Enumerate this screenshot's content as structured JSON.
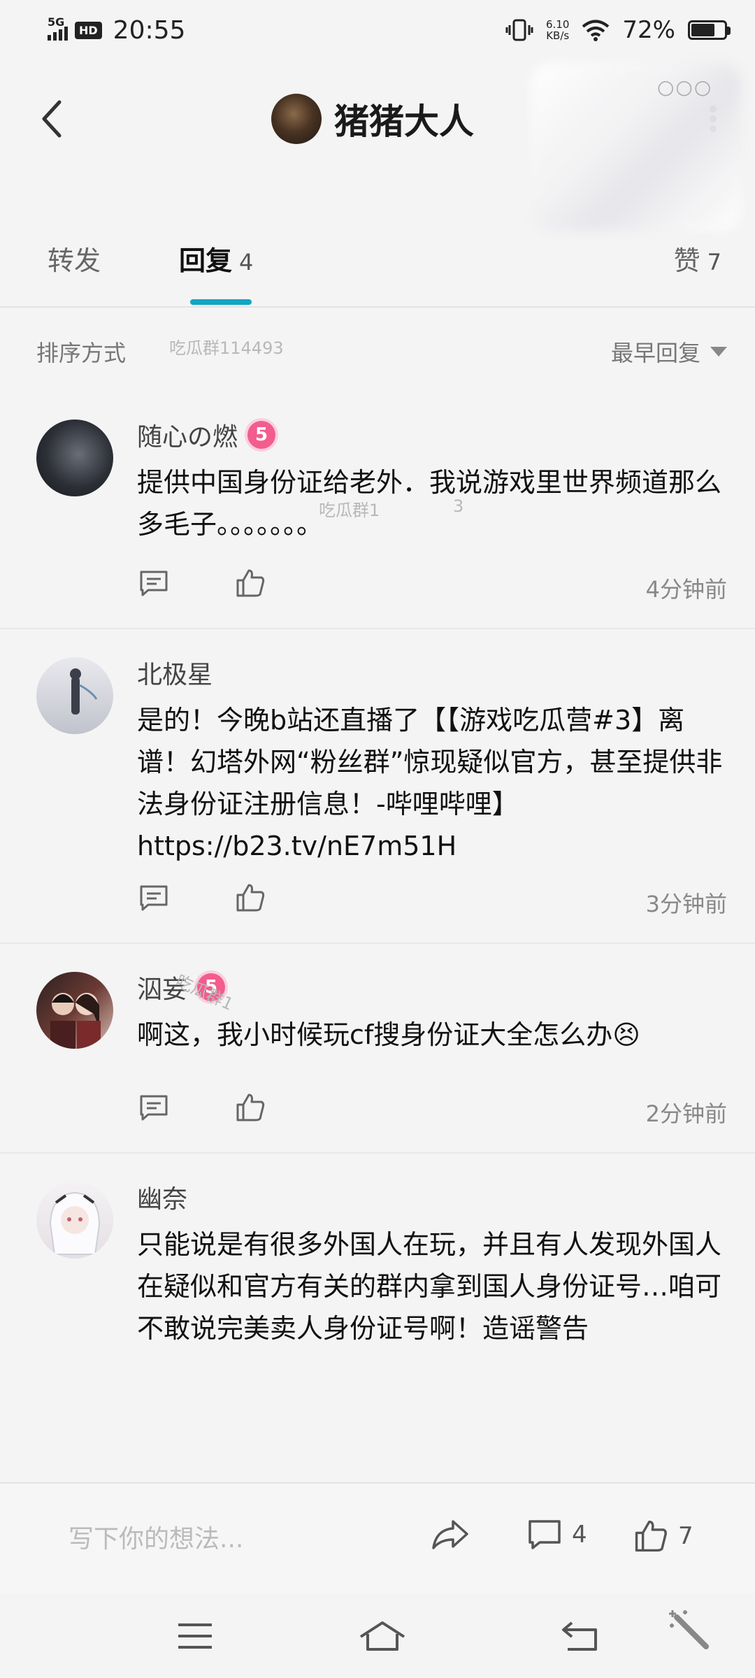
{
  "status_bar": {
    "network": "5G",
    "hd": "HD",
    "time": "20:55",
    "net_speed_value": "6.10",
    "net_speed_unit": "KB/s",
    "battery": "72%",
    "battery_level": 0.72
  },
  "header": {
    "title": "猪猪大人"
  },
  "tabs": [
    {
      "label": "转发",
      "count": ""
    },
    {
      "label": "回复",
      "count": "4"
    },
    {
      "label": "赞",
      "count": "7"
    }
  ],
  "sort": {
    "label": "排序方式",
    "selected": "最早回复"
  },
  "watermarks": [
    "吃瓜群114493",
    "吃瓜群1",
    "3",
    "吃瓜群1"
  ],
  "comments": [
    {
      "name": "随心の燃",
      "level": "5",
      "text": "提供中国身份证给老外．我说游戏里世界频道那么多毛子。。。。。。。",
      "time": "4分钟前"
    },
    {
      "name": "北极星",
      "level": "",
      "text": "是的！今晚b站还直播了【【游戏吃瓜营#3】离谱！幻塔外网“粉丝群”惊现疑似官方，甚至提供非法身份证注册信息！-哔哩哔哩】https://b23.tv/nE7m51H",
      "time": "3分钟前"
    },
    {
      "name": "泅妄",
      "level": "5",
      "text": "啊这，我小时候玩cf搜身份证大全怎么办😣",
      "time": "2分钟前"
    },
    {
      "name": "幽奈",
      "level": "",
      "text": "只能说是有很多外国人在玩，并且有人发现外国人在疑似和官方有关的群内拿到国人身份证号…咱可不敢说完美卖人身份证号啊！造谣警告",
      "time": ""
    }
  ],
  "bottom_bar": {
    "placeholder": "写下你的想法...",
    "comment_count": "4",
    "like_count": "7"
  }
}
